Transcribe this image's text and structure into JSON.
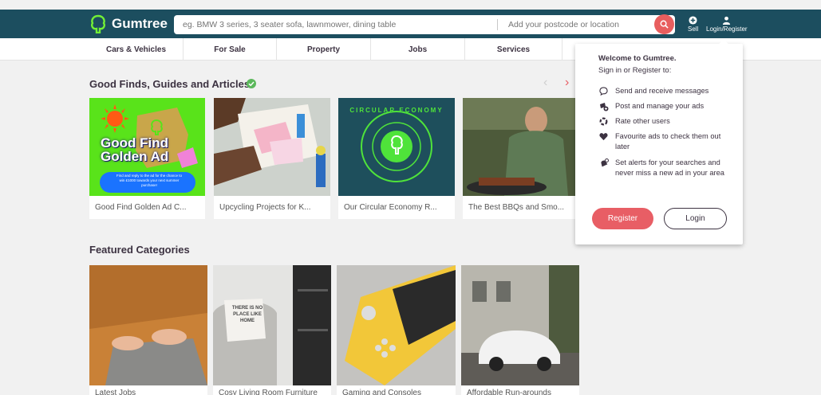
{
  "header": {
    "logo_text": "Gumtree",
    "search_placeholder": "eg. BMW 3 series, 3 seater sofa, lawnmower, dining table",
    "location_placeholder": "Add your postcode or location",
    "sell_label": "Sell",
    "login_label": "Login/Register"
  },
  "categories": [
    "Cars & Vehicles",
    "For Sale",
    "Property",
    "Jobs",
    "Services"
  ],
  "good_finds": {
    "title": "Good Finds, Guides and Articles",
    "cards": [
      {
        "caption": "Good Find Golden Ad C...",
        "badge_line1": "Good Find",
        "badge_line2": "Golden Ad",
        "small_text": "Find and reply to the ad for the chance to win £1000 towards your next summer purchase!"
      },
      {
        "caption": "Upcycling Projects for K..."
      },
      {
        "caption": "Our Circular Economy R...",
        "ring_text": "CIRCULAR ECONOMY"
      },
      {
        "caption": "The Best BBQs and Smo..."
      }
    ]
  },
  "featured": {
    "title": "Featured Categories",
    "cards": [
      {
        "caption": "Latest Jobs"
      },
      {
        "caption": "Cosy Living Room Furniture",
        "pillow_text": "THERE IS NO PLACE LIKE HOME"
      },
      {
        "caption": "Gaming and Consoles"
      },
      {
        "caption": "Affordable Run-arounds"
      }
    ]
  },
  "popup": {
    "title": "Welcome to Gumtree.",
    "subtitle": "Sign in or Register to:",
    "items": [
      "Send and receive messages",
      "Post and manage your ads",
      "Rate other users",
      "Favourite ads to check them out later",
      "Set alerts for your searches and never miss a new ad in your area"
    ],
    "register_label": "Register",
    "login_label": "Login"
  },
  "colors": {
    "header_bg": "#1c4e5f",
    "accent": "#e85e65",
    "brand_green": "#72ef36"
  }
}
